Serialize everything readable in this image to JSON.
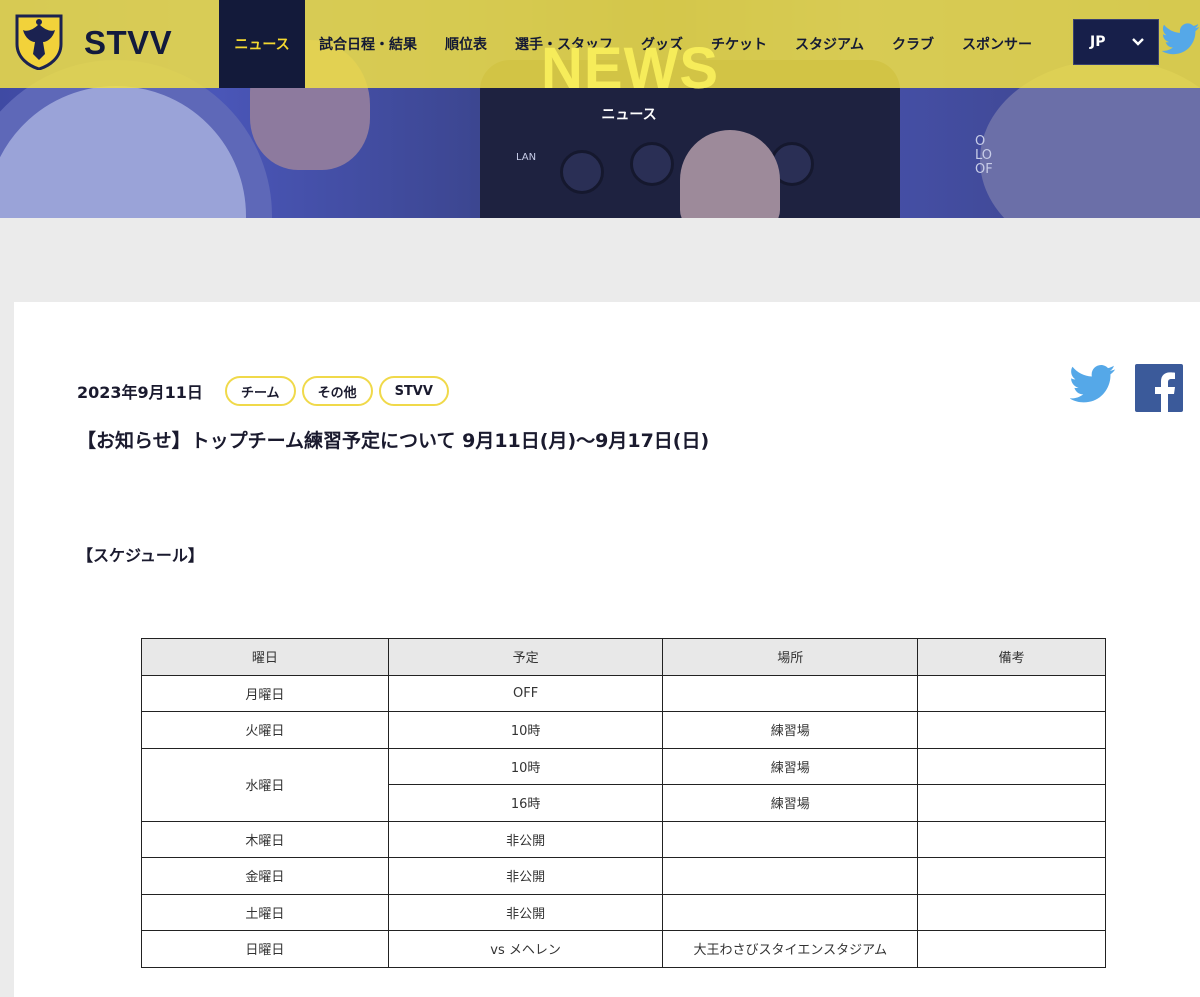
{
  "header": {
    "brand": "STVV",
    "nav": [
      {
        "label": "ニュース",
        "active": true
      },
      {
        "label": "試合日程・結果"
      },
      {
        "label": "順位表"
      },
      {
        "label": "選手・スタッフ"
      },
      {
        "label": "グッズ"
      },
      {
        "label": "チケット"
      },
      {
        "label": "スタジアム"
      },
      {
        "label": "クラブ"
      },
      {
        "label": "スポンサー"
      }
    ],
    "lang": "JP"
  },
  "hero": {
    "title": "NEWS",
    "subtitle": "ニュース",
    "label_lan": "LAN",
    "label_off": "O\nLO\nOF"
  },
  "article": {
    "date": "2023年9月11日",
    "tags": [
      "チーム",
      "その他",
      "STVV"
    ],
    "title": "【お知らせ】トップチーム練習予定について 9月11日(月)〜9月17日(日)",
    "section": "【スケジュール】",
    "table": {
      "headers": [
        "曜日",
        "予定",
        "場所",
        "備考"
      ],
      "rows": [
        [
          "月曜日",
          "OFF",
          "",
          ""
        ],
        [
          "火曜日",
          "10時",
          "練習場",
          ""
        ],
        [
          "水曜日",
          "10時",
          "練習場",
          ""
        ],
        [
          "",
          "16時",
          "練習場",
          ""
        ],
        [
          "木曜日",
          "非公開",
          "",
          ""
        ],
        [
          "金曜日",
          "非公開",
          "",
          ""
        ],
        [
          "土曜日",
          "非公開",
          "",
          ""
        ],
        [
          "日曜日",
          "vs メヘレン",
          "大王わさびスタイエンスタジアム",
          ""
        ]
      ]
    }
  },
  "colors": {
    "accent_yellow": "#f0df46",
    "navy": "#131a3a",
    "twitter_blue": "#55a8e8",
    "facebook_blue": "#3b5a9a"
  }
}
